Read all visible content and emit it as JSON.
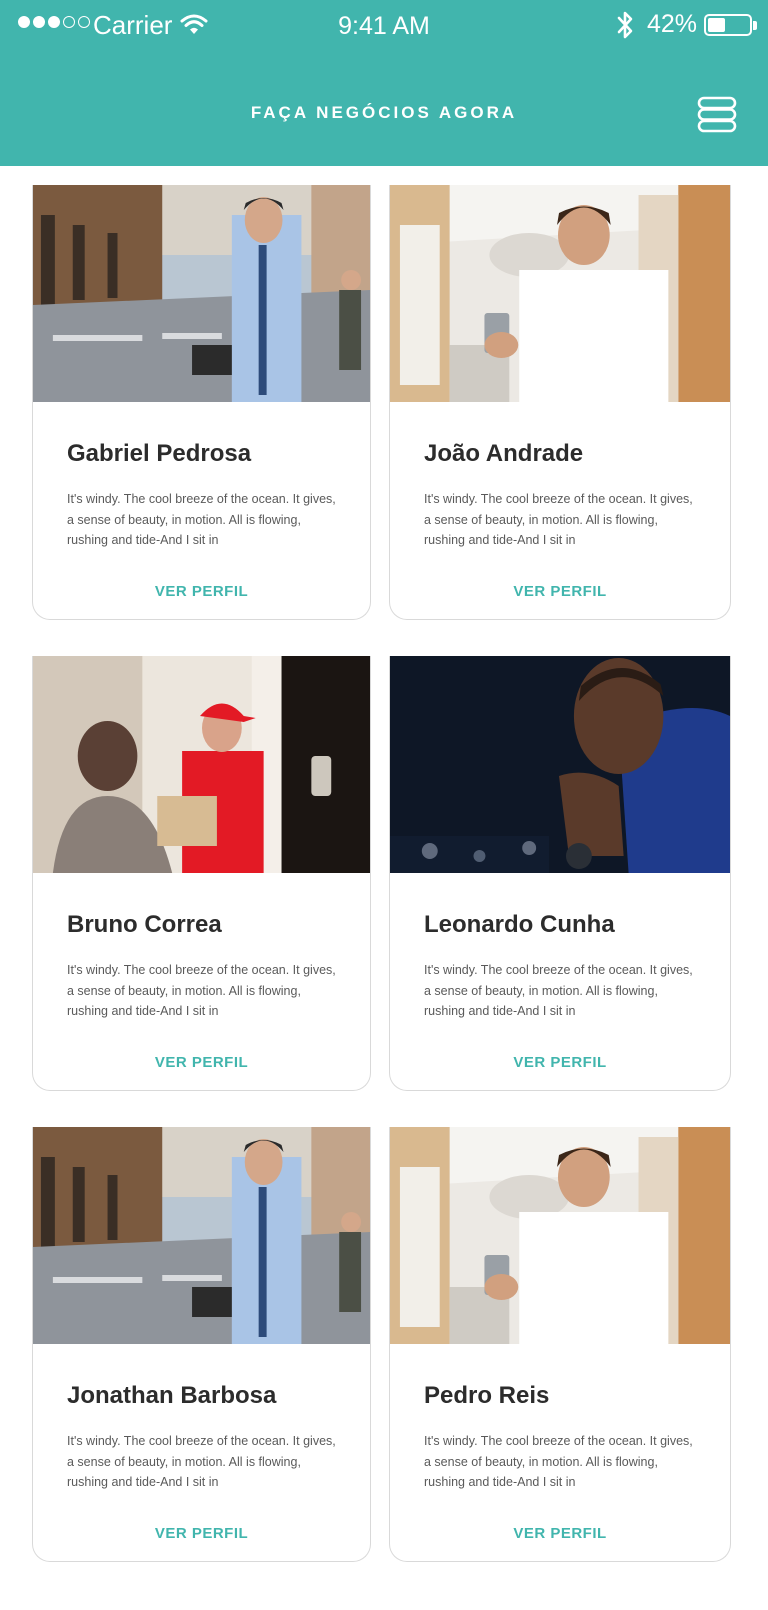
{
  "status_bar": {
    "carrier": "Carrier",
    "time": "9:41 AM",
    "battery_percent": "42%",
    "battery_level": 0.42
  },
  "header": {
    "title": "FAÇA NEGÓCIOS AGORA",
    "menu_icon": "stack-menu-icon",
    "background_color": "#41b5ad"
  },
  "cards": [
    {
      "name": "Gabriel Pedrosa",
      "description": "It's windy. The cool breeze of the ocean. It gives, a sense of beauty, in motion. All is flowing, rushing and tide-And I sit in",
      "link": "VER PERFIL"
    },
    {
      "name": "João Andrade",
      "description": "It's windy. The cool breeze of the ocean. It gives, a sense of beauty, in motion. All is flowing, rushing and tide-And I sit in",
      "link": "VER PERFIL"
    },
    {
      "name": "Bruno Correa",
      "description": "It's windy. The cool breeze of the ocean. It gives, a sense of beauty, in motion. All is flowing, rushing and tide-And I sit in",
      "link": "VER PERFIL"
    },
    {
      "name": "Leonardo Cunha",
      "description": "It's windy. The cool breeze of the ocean. It gives, a sense of beauty, in motion. All is flowing, rushing and tide-And I sit in",
      "link": "VER PERFIL"
    },
    {
      "name": "Jonathan Barbosa",
      "description": "It's windy. The cool breeze of the ocean. It gives, a sense of beauty, in motion. All is flowing, rushing and tide-And I sit in",
      "link": "VER PERFIL"
    },
    {
      "name": "Pedro Reis",
      "description": "It's windy. The cool breeze of the ocean. It gives, a sense of beauty, in motion. All is flowing, rushing and tide-And I sit in",
      "link": "VER PERFIL"
    }
  ],
  "accent_color": "#41b5ad"
}
